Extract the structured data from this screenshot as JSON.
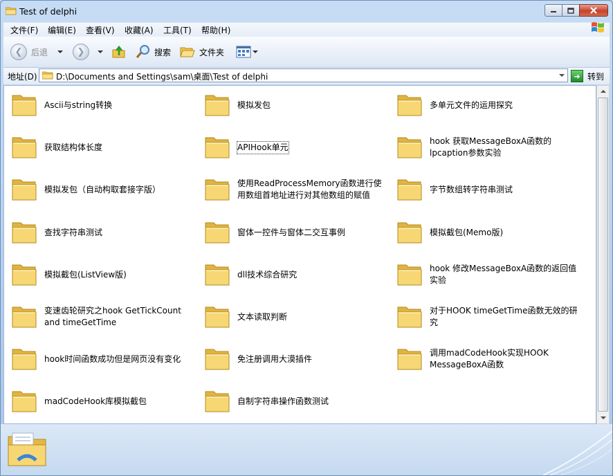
{
  "window": {
    "title": "Test of delphi",
    "icon": "folder-icon",
    "controls": {
      "minimize": "minimize-icon",
      "maximize": "maximize-icon",
      "close": "close-icon"
    }
  },
  "menu": [
    "文件(F)",
    "编辑(E)",
    "查看(V)",
    "收藏(A)",
    "工具(T)",
    "帮助(H)"
  ],
  "toolbar": {
    "back_label": "后退",
    "search_label": "搜索",
    "folders_label": "文件夹"
  },
  "address": {
    "label": "地址(D)",
    "path": "D:\\Documents and Settings\\sam\\桌面\\Test of delphi",
    "go_label": "转到"
  },
  "folders": [
    {
      "name": "Ascii与string转换"
    },
    {
      "name": "模拟发包"
    },
    {
      "name": "多单元文件的运用探究"
    },
    {
      "name": "获取结构体长度"
    },
    {
      "name": "APIHook单元",
      "selected": true
    },
    {
      "name": "hook 获取MessageBoxA函数的lpcaption参数实验"
    },
    {
      "name": "模拟发包（自动构取套接字版）"
    },
    {
      "name": "使用ReadProcessMemory函数进行使用数组首地址进行对其他数组的赋值"
    },
    {
      "name": "字节数组转字符串测试"
    },
    {
      "name": "查找字符串测试"
    },
    {
      "name": "窗体一控件与窗体二交互事例"
    },
    {
      "name": "模拟截包(Memo版)"
    },
    {
      "name": "模拟截包(ListView版)"
    },
    {
      "name": "dll技术综合研究"
    },
    {
      "name": "hook 修改MessageBoxA函数的返回值实验"
    },
    {
      "name": "变速齿轮研究之hook GetTickCount and timeGetTime"
    },
    {
      "name": "文本读取判断"
    },
    {
      "name": "对于HOOK timeGetTime函数无效的研究"
    },
    {
      "name": "hook时间函数成功但是网页没有变化"
    },
    {
      "name": "免注册调用大漠插件"
    },
    {
      "name": "调用madCodeHook实现HOOK MessageBoxA函数"
    },
    {
      "name": "madCodeHook库模拟截包"
    },
    {
      "name": "自制字符串操作函数测试"
    }
  ],
  "colors": {
    "folder_fill": "#f7d774",
    "folder_dark": "#e0b440",
    "window_frame": "#c6dcf5"
  }
}
